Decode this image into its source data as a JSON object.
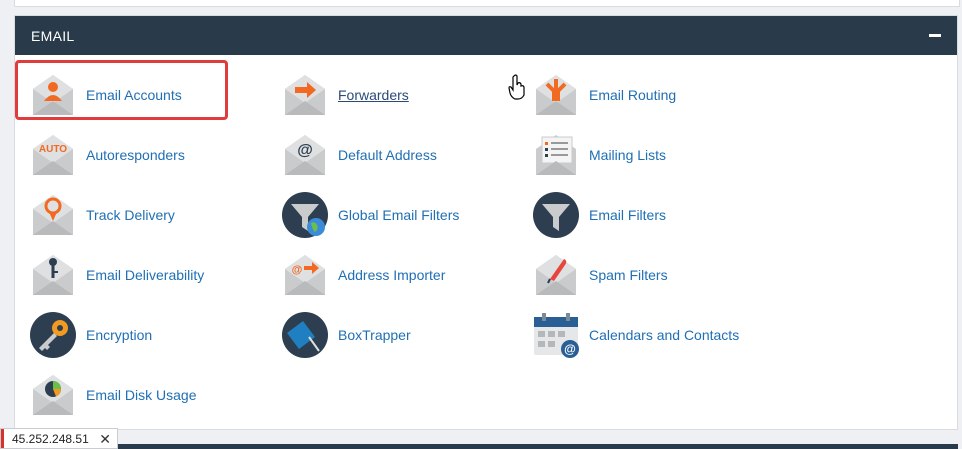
{
  "section": {
    "title": "EMAIL"
  },
  "items": [
    {
      "label": "Email Accounts",
      "icon": "email-accounts-icon"
    },
    {
      "label": "Forwarders",
      "icon": "forwarders-icon"
    },
    {
      "label": "Email Routing",
      "icon": "email-routing-icon"
    },
    {
      "label": "Autoresponders",
      "icon": "autoresponders-icon"
    },
    {
      "label": "Default Address",
      "icon": "default-address-icon"
    },
    {
      "label": "Mailing Lists",
      "icon": "mailing-lists-icon"
    },
    {
      "label": "Track Delivery",
      "icon": "track-delivery-icon"
    },
    {
      "label": "Global Email Filters",
      "icon": "global-email-filters-icon"
    },
    {
      "label": "Email Filters",
      "icon": "email-filters-icon"
    },
    {
      "label": "Email Deliverability",
      "icon": "email-deliverability-icon"
    },
    {
      "label": "Address Importer",
      "icon": "address-importer-icon"
    },
    {
      "label": "Spam Filters",
      "icon": "spam-filters-icon"
    },
    {
      "label": "Encryption",
      "icon": "encryption-icon"
    },
    {
      "label": "BoxTrapper",
      "icon": "boxtrapper-icon"
    },
    {
      "label": "Calendars and Contacts",
      "icon": "calendars-contacts-icon"
    },
    {
      "label": "Email Disk Usage",
      "icon": "email-disk-usage-icon"
    }
  ],
  "icon_texts": {
    "auto": "AUTO",
    "at": "@"
  },
  "status_bar": {
    "ip": "45.252.248.51",
    "close": "✕"
  },
  "colors": {
    "header_bg": "#293a4a",
    "link": "#1f6fb5",
    "accent_orange": "#f26a21",
    "highlight_red": "#e23b3b",
    "dark_circle": "#2c3e50"
  }
}
